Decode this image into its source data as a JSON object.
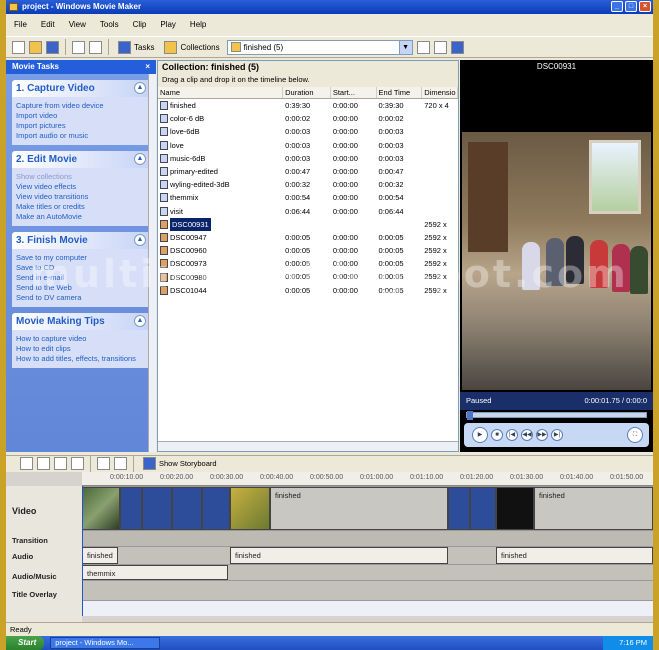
{
  "window": {
    "title": "project - Windows Movie Maker"
  },
  "menu": [
    "File",
    "Edit",
    "View",
    "Tools",
    "Clip",
    "Play",
    "Help"
  ],
  "toolbar": {
    "tasks_label": "Tasks",
    "collections_label": "Collections",
    "collection_value": "finished (5)"
  },
  "tasks": {
    "header": "Movie Tasks",
    "close": "×",
    "groups": [
      {
        "title": "1. Capture Video",
        "items": [
          "Capture from video device",
          "Import video",
          "Import pictures",
          "Import audio or music"
        ]
      },
      {
        "title": "2. Edit Movie",
        "items": [
          "Show collections",
          "View video effects",
          "View video transitions",
          "Make titles or credits",
          "Make an AutoMovie"
        ]
      },
      {
        "title": "3. Finish Movie",
        "items": [
          "Save to my computer",
          "Save to CD",
          "Send in e-mail",
          "Send to the Web",
          "Send to DV camera"
        ]
      },
      {
        "title": "Movie Making Tips",
        "items": [
          "How to capture video",
          "How to edit clips",
          "How to add titles, effects, transitions"
        ]
      }
    ]
  },
  "collection": {
    "title": "Collection: finished (5)",
    "hint": "Drag a clip and drop it on the timeline below.",
    "columns": [
      "Name",
      "Duration",
      "Start...",
      "End Time",
      "Dimensio"
    ],
    "rows": [
      {
        "name": "finished",
        "duration": "0:39:30",
        "start": "0:00:00",
        "end": "0:39:30",
        "dim": "720 x 4"
      },
      {
        "name": "color-6 dB",
        "duration": "0:00:02",
        "start": "0:00:00",
        "end": "0:00:02",
        "dim": ""
      },
      {
        "name": "love-6dB",
        "duration": "0:00:03",
        "start": "0:00:00",
        "end": "0:00:03",
        "dim": ""
      },
      {
        "name": "love",
        "duration": "0:00:03",
        "start": "0:00:00",
        "end": "0:00:03",
        "dim": ""
      },
      {
        "name": "music-6dB",
        "duration": "0:00:03",
        "start": "0:00:00",
        "end": "0:00:03",
        "dim": ""
      },
      {
        "name": "primary-edited",
        "duration": "0:00:47",
        "start": "0:00:00",
        "end": "0:00:47",
        "dim": ""
      },
      {
        "name": "wyling-edited-3dB",
        "duration": "0:00:32",
        "start": "0:00:00",
        "end": "0:00:32",
        "dim": ""
      },
      {
        "name": "themmix",
        "duration": "0:00:54",
        "start": "0:00:00",
        "end": "0:00:54",
        "dim": ""
      },
      {
        "name": "visit",
        "duration": "0:06:44",
        "start": "0:00:00",
        "end": "0:06:44",
        "dim": ""
      },
      {
        "name": "DSC00931",
        "duration": "",
        "start": "",
        "end": "",
        "dim": "2592 x"
      },
      {
        "name": "DSC00947",
        "duration": "0:00:05",
        "start": "0:00:00",
        "end": "0:00:05",
        "dim": "2592 x"
      },
      {
        "name": "DSC00960",
        "duration": "0:00:05",
        "start": "0:00:00",
        "end": "0:00:05",
        "dim": "2592 x"
      },
      {
        "name": "DSC00973",
        "duration": "0:00:05",
        "start": "0:00:00",
        "end": "0:00:05",
        "dim": "2592 x"
      },
      {
        "name": "DSC00980",
        "duration": "0:00:05",
        "start": "0:00:00",
        "end": "0:00:05",
        "dim": "2592 x"
      },
      {
        "name": "DSC01044",
        "duration": "0:00:05",
        "start": "0:00:00",
        "end": "0:00:05",
        "dim": "2592 x"
      }
    ]
  },
  "monitor": {
    "title": "DSC00931",
    "state": "Paused",
    "time": "0:00:01.75 / 0:00:0"
  },
  "timeline": {
    "storyboard_label": "Show Storyboard",
    "ruler": [
      "0:00:10.00",
      "0:00:20.00",
      "0:00:30.00",
      "0:00:40.00",
      "0:00:50.00",
      "0:01:00.00",
      "0:01:10.00",
      "0:01:20.00",
      "0:01:30.00",
      "0:01:40.00",
      "0:01:50.00"
    ],
    "tracks": [
      "Video",
      "Transition",
      "Audio",
      "Audio/Music",
      "Title Overlay"
    ],
    "video_clip_label": "finished",
    "audio_clip_label": "finished",
    "music_clip_label": "themmix"
  },
  "status": {
    "text": "Ready"
  },
  "taskbar": {
    "start": "Start",
    "item": "project - Windows Mo...",
    "clock": "7:16 PM"
  },
  "watermark": "multimediablogspot.com"
}
